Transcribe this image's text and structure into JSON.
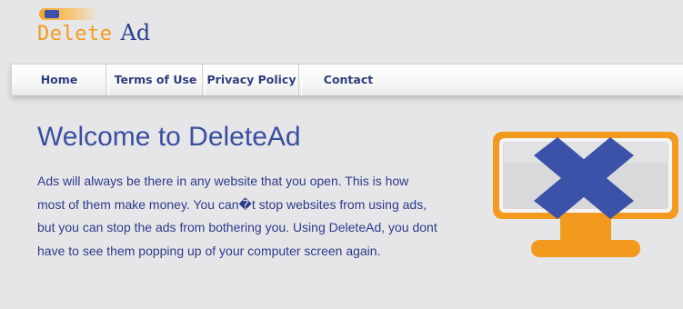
{
  "logo": {
    "word1": "Delete",
    "word2": "Ad"
  },
  "nav": {
    "items": [
      {
        "label": "Home"
      },
      {
        "label": "Terms of Use"
      },
      {
        "label": "Privacy Policy"
      },
      {
        "label": "Contact"
      }
    ]
  },
  "main": {
    "title": "Welcome to DeleteAd",
    "intro": "Ads will always be there in any website that you open. This is how most of them make money. You can�t stop websites from using ads, but you can stop the ads from bothering you. Using DeleteAd, you dont have to see them popping up of your computer screen again."
  },
  "colors": {
    "accent_orange": "#f39a1e",
    "accent_blue": "#3b52a8",
    "text_blue": "#2d3a8a",
    "background": "#e6e6e8"
  },
  "icons": {
    "hero": "monitor-with-x-icon"
  }
}
